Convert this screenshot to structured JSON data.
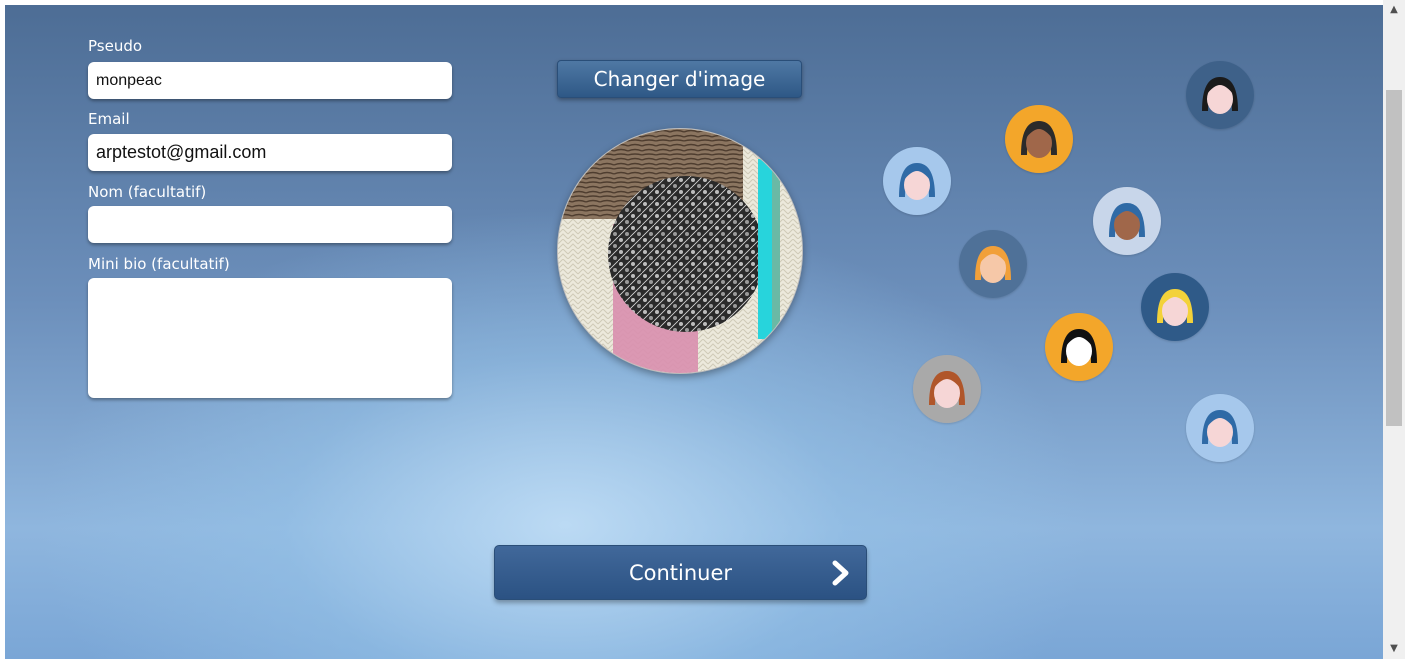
{
  "form": {
    "pseudo": {
      "label": "Pseudo",
      "value": "monpeac"
    },
    "email": {
      "label": "Email",
      "value": "arptestot@gmail.com"
    },
    "nom": {
      "label": "Nom (facultatif)",
      "value": ""
    },
    "bio": {
      "label": "Mini bio (facultatif)",
      "value": ""
    }
  },
  "image": {
    "change_label": "Changer d'image"
  },
  "continue_label": "Continuer",
  "avatars": [
    {
      "name": "avatar-dark-hair-woman",
      "bg": "#3e6189",
      "skin": "#f6d6d6",
      "hair": "#1b1b1b"
    },
    {
      "name": "avatar-glasses-man",
      "bg": "#f3a62a",
      "skin": "#a0674a",
      "hair": "#2b2b2b"
    },
    {
      "name": "avatar-blue-hair-girl",
      "bg": "#a6c8ec",
      "skin": "#f6d6d6",
      "hair": "#2f6aa6"
    },
    {
      "name": "avatar-blue-hair-boy",
      "bg": "#c8d6ea",
      "skin": "#a0674a",
      "hair": "#2f6aa6"
    },
    {
      "name": "avatar-bearded-man",
      "bg": "#4f7198",
      "skin": "#f6c8a8",
      "hair": "#f1a03a"
    },
    {
      "name": "avatar-blonde-woman",
      "bg": "#2f5a88",
      "skin": "#f6d6d6",
      "hair": "#f3d23a"
    },
    {
      "name": "avatar-black-hair-woman",
      "bg": "#f3a62a",
      "skin": "#ffffff",
      "hair": "#111111"
    },
    {
      "name": "avatar-red-hair-boy",
      "bg": "#a9a9a9",
      "skin": "#f6d6d6",
      "hair": "#b0562a"
    },
    {
      "name": "avatar-blue-hair-man",
      "bg": "#a6c8ec",
      "skin": "#f6d6d6",
      "hair": "#2f6aa6"
    }
  ]
}
